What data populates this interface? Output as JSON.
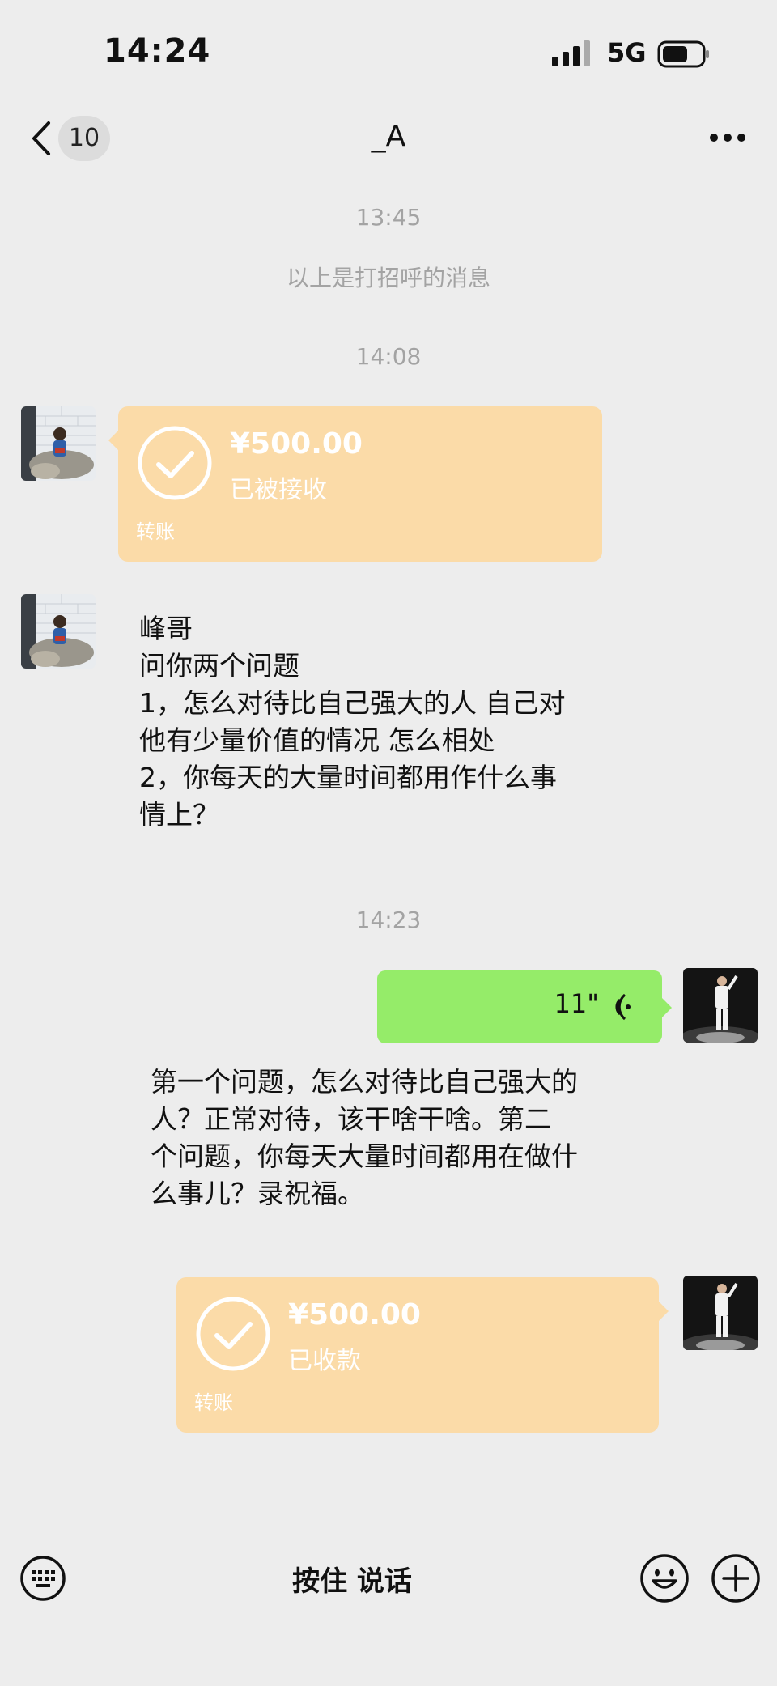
{
  "status_bar": {
    "time": "14:24",
    "network": "5G"
  },
  "nav": {
    "unread_count": "10",
    "title": "_A"
  },
  "timestamps": {
    "t1": "13:45",
    "t2": "14:08",
    "t3": "14:23"
  },
  "system_notice": "以上是打招呼的消息",
  "transfer_received": {
    "amount": "¥500.00",
    "status": "已被接收",
    "label": "转账"
  },
  "text_message_1": "峰哥\n问你两个问题\n1，怎么对待比自己强大的人 自己对\n他有少量价值的情况 怎么相处\n2，你每天的大量时间都用作什么事\n情上？",
  "voice_message": {
    "duration": "11\""
  },
  "voice_transcript": "第一个问题，怎么对待比自己强大的\n人？正常对待，该干啥干啥。第二\n个问题，你每天大量时间都用在做什\n么事儿？录祝福。",
  "transfer_sent": {
    "amount": "¥500.00",
    "status": "已收款",
    "label": "转账"
  },
  "input_bar": {
    "hold_to_talk": "按住 说话"
  },
  "colors": {
    "background": "#ededed",
    "transfer": "#fbdba8",
    "voice_bubble": "#95ec69"
  },
  "icons": [
    "signal-icon",
    "battery-icon",
    "back-icon",
    "more-icon",
    "check-icon",
    "voice-wave-icon",
    "keyboard-icon",
    "emoji-icon",
    "plus-icon"
  ]
}
